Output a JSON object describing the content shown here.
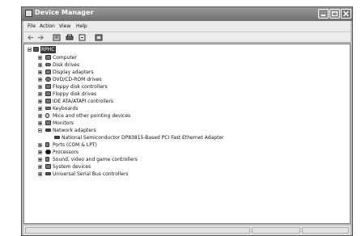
{
  "window": {
    "title": "Device Manager"
  },
  "menu": [
    "File",
    "Action",
    "View",
    "Help"
  ],
  "toolbar": [
    "back-icon",
    "forward-icon",
    "properties-icon",
    "print-icon",
    "scan-hardware-icon",
    "help-icon"
  ],
  "tree": {
    "root": "RPHC",
    "items": [
      {
        "label": "Computer",
        "icon": "computer-icon"
      },
      {
        "label": "Disk drives",
        "icon": "disk-drive-icon"
      },
      {
        "label": "Display adapters",
        "icon": "display-adapter-icon"
      },
      {
        "label": "DVD/CD-ROM drives",
        "icon": "cdrom-icon"
      },
      {
        "label": "Floppy disk controllers",
        "icon": "floppy-controller-icon"
      },
      {
        "label": "Floppy disk drives",
        "icon": "floppy-drive-icon"
      },
      {
        "label": "IDE ATA/ATAPI controllers",
        "icon": "ide-controller-icon"
      },
      {
        "label": "Keyboards",
        "icon": "keyboard-icon"
      },
      {
        "label": "Mice and other pointing devices",
        "icon": "mouse-icon"
      },
      {
        "label": "Monitors",
        "icon": "monitor-icon"
      },
      {
        "label": "Network adapters",
        "icon": "network-adapter-icon",
        "expanded": true
      },
      {
        "label": "National Semiconductor DP83815-Based PCI Fast Ethernet Adapter",
        "icon": "nic-icon",
        "child": true
      },
      {
        "label": "Ports (COM & LPT)",
        "icon": "port-icon"
      },
      {
        "label": "Processors",
        "icon": "processor-icon"
      },
      {
        "label": "Sound, video and game controllers",
        "icon": "sound-icon"
      },
      {
        "label": "System devices",
        "icon": "system-device-icon"
      },
      {
        "label": "Universal Serial Bus controllers",
        "icon": "usb-icon"
      }
    ]
  }
}
